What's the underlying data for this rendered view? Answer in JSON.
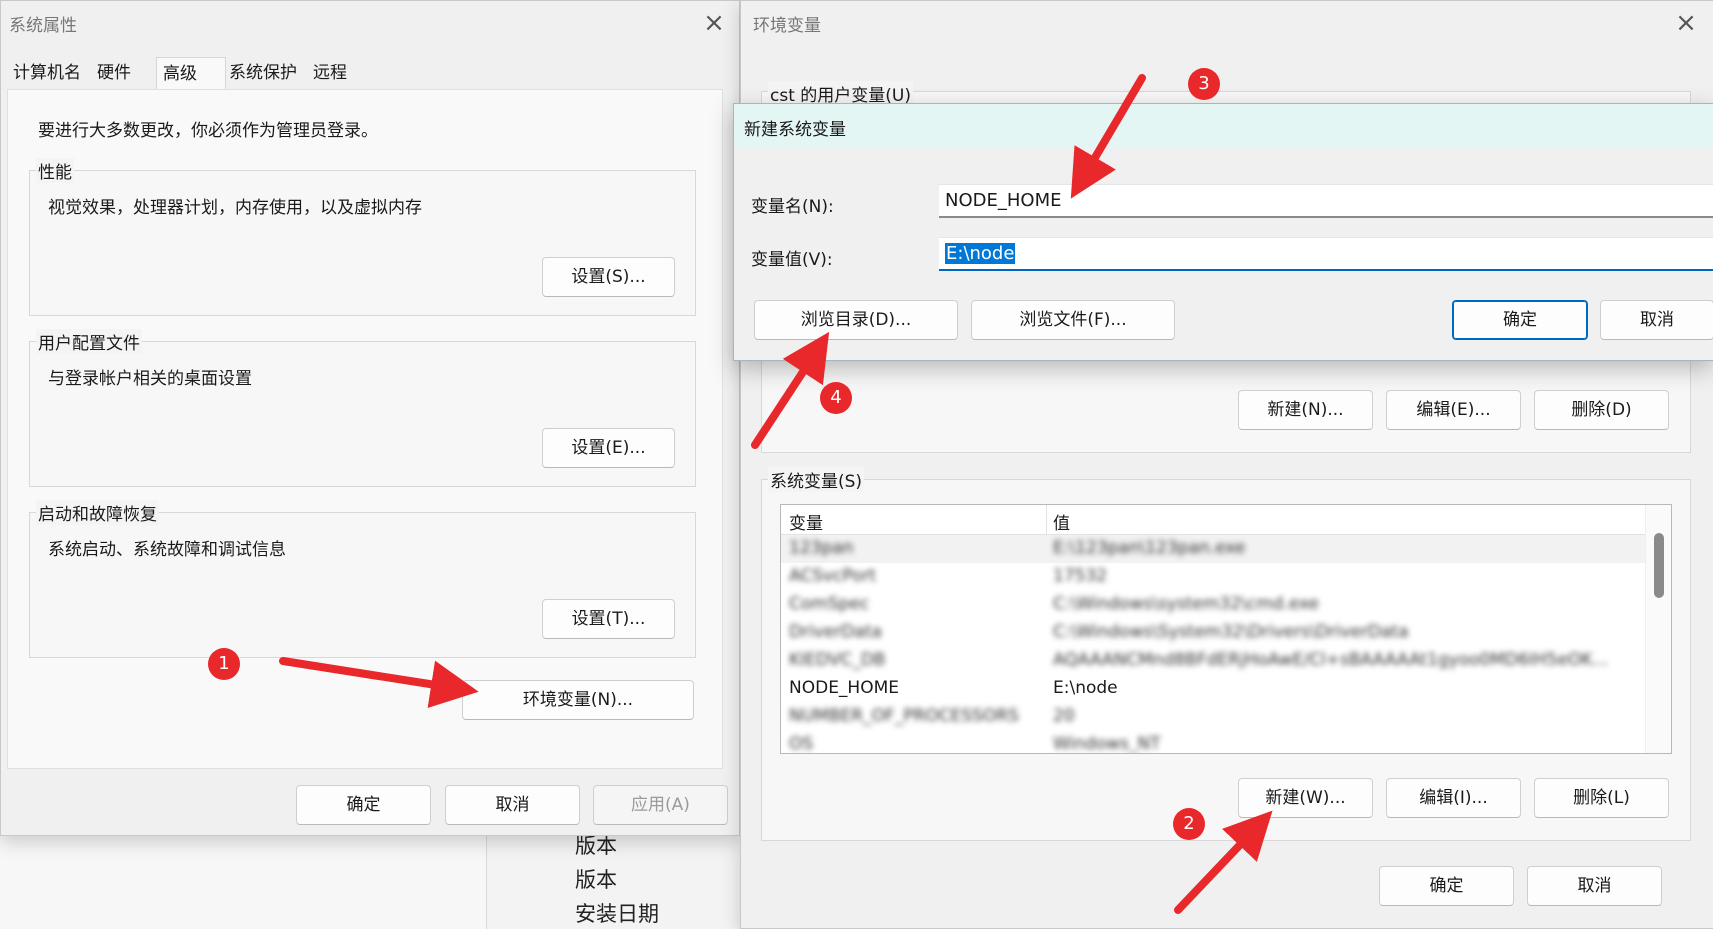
{
  "background": {
    "items": [
      "版本",
      "版本",
      "安装日期"
    ]
  },
  "system_properties": {
    "title": "系统属性",
    "tabs": [
      {
        "label": "计算机名"
      },
      {
        "label": "硬件"
      },
      {
        "label": "高级"
      },
      {
        "label": "系统保护"
      },
      {
        "label": "远程"
      }
    ],
    "admin_note": "要进行大多数更改，你必须作为管理员登录。",
    "performance": {
      "label": "性能",
      "desc": "视觉效果，处理器计划，内存使用，以及虚拟内存",
      "button": "设置(S)..."
    },
    "user_profiles": {
      "label": "用户配置文件",
      "desc": "与登录帐户相关的桌面设置",
      "button": "设置(E)..."
    },
    "startup_recovery": {
      "label": "启动和故障恢复",
      "desc": "系统启动、系统故障和调试信息",
      "button": "设置(T)..."
    },
    "env_button": "环境变量(N)...",
    "ok": "确定",
    "cancel": "取消",
    "apply": "应用(A)"
  },
  "env_vars": {
    "title": "环境变量",
    "user_section": "cst 的用户变量(U)",
    "user_buttons": {
      "new": "新建(N)...",
      "edit": "编辑(E)...",
      "delete": "删除(D)"
    },
    "system_section": "系统变量(S)",
    "columns": {
      "name": "变量",
      "value": "值"
    },
    "rows": [
      {
        "name": "123pan",
        "value": "E:\\123pan\\123pan.exe",
        "blurred": true
      },
      {
        "name": "ACSvcPort",
        "value": "17532",
        "blurred": true
      },
      {
        "name": "ComSpec",
        "value": "C:\\Windows\\system32\\cmd.exe",
        "blurred": true
      },
      {
        "name": "DriverData",
        "value": "C:\\Windows\\System32\\Drivers\\DriverData",
        "blurred": true
      },
      {
        "name": "KIEDVC_DB",
        "value": "AQAAANCMnd8BFdERjHoAwE/Cl+sBAAAAAt1gyoo0MD6IH5eOK...",
        "blurred": true
      },
      {
        "name": "NODE_HOME",
        "value": "E:\\node",
        "blurred": false
      },
      {
        "name": "NUMBER_OF_PROCESSORS",
        "value": "20",
        "blurred": true
      },
      {
        "name": "OS",
        "value": "Windows_NT",
        "blurred": true
      }
    ],
    "system_buttons": {
      "new": "新建(W)...",
      "edit": "编辑(I)...",
      "delete": "删除(L)"
    },
    "ok": "确定",
    "cancel": "取消"
  },
  "new_system_var": {
    "title": "新建系统变量",
    "name_label": "变量名(N):",
    "name_value": "NODE_HOME",
    "value_label": "变量值(V):",
    "value_value": "E:\\node",
    "browse_dir": "浏览目录(D)...",
    "browse_file": "浏览文件(F)...",
    "ok": "确定",
    "cancel": "取消"
  },
  "annotations": {
    "markers": [
      "1",
      "2",
      "3",
      "4"
    ],
    "color": "#e8282a"
  }
}
